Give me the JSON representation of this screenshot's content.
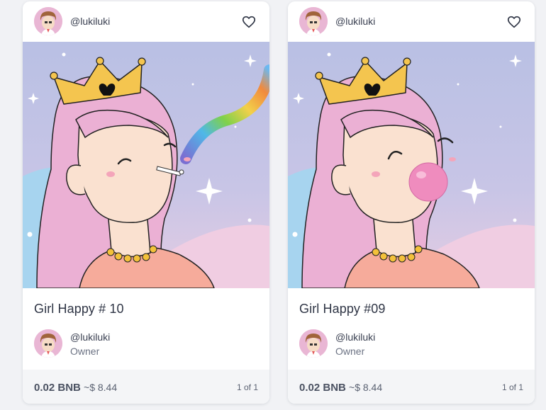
{
  "cards": [
    {
      "author_handle": "@lukiluki",
      "title": "Girl Happy # 10",
      "owner_handle": "@lukiluki",
      "owner_role": "Owner",
      "price_bnb": "0.02 BNB",
      "price_usd": "~$ 8.44",
      "edition": "1 of 1",
      "artwork": "girl with crown smoking rainbow"
    },
    {
      "author_handle": "@lukiluki",
      "title": "Girl Happy #09",
      "owner_handle": "@lukiluki",
      "owner_role": "Owner",
      "price_bnb": "0.02 BNB",
      "price_usd": "~$ 8.44",
      "edition": "1 of 1",
      "artwork": "girl with crown blowing bubble gum"
    }
  ],
  "icons": {
    "favorite": "heart-outline-icon"
  },
  "colors": {
    "card_bg": "#ffffff",
    "page_bg": "#f1f2f5",
    "footer_bg": "#f4f5f7",
    "text_primary": "#2f3545",
    "text_secondary": "#6b7283"
  }
}
